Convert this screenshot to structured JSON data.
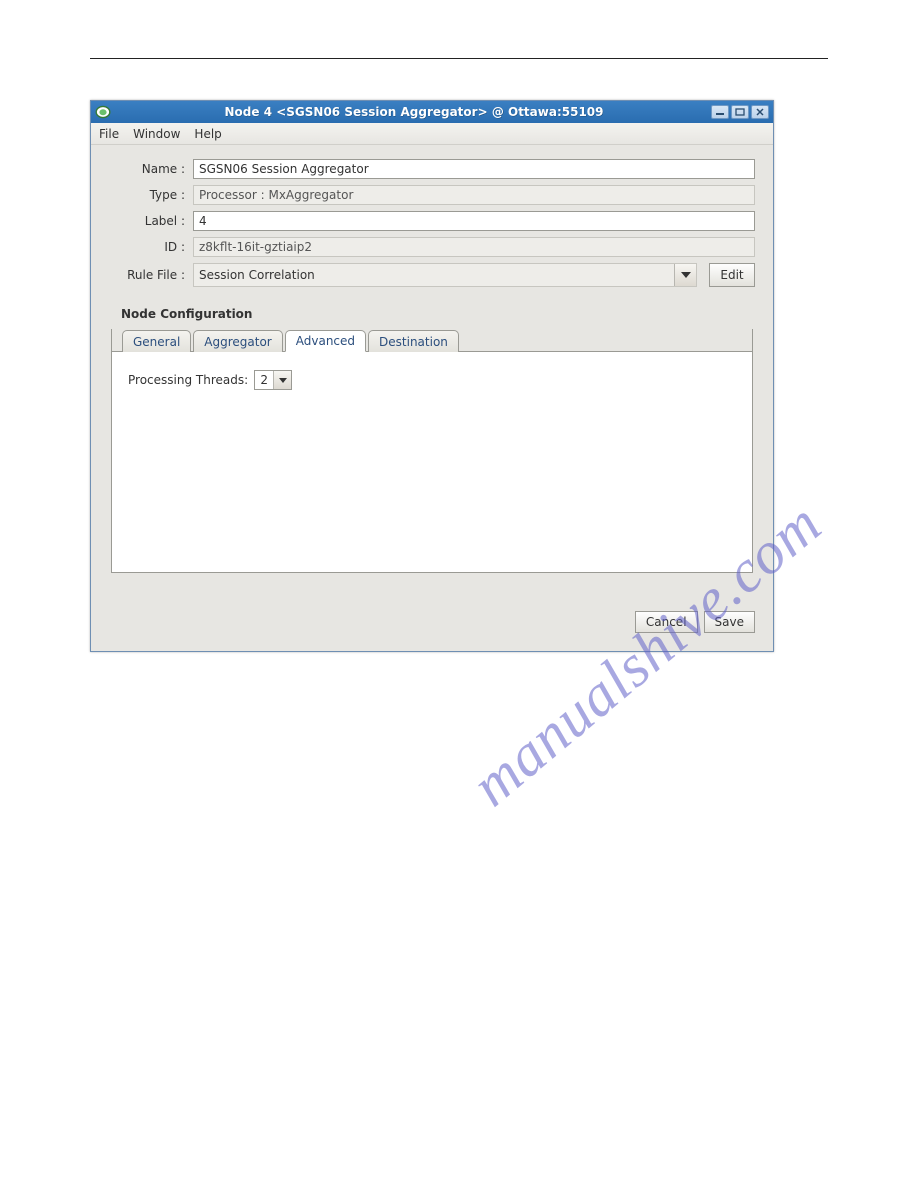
{
  "window": {
    "title": "Node 4 <SGSN06 Session Aggregator> @ Ottawa:55109"
  },
  "menubar": {
    "file": "File",
    "window": "Window",
    "help": "Help"
  },
  "form": {
    "name_label": "Name :",
    "name_value": "SGSN06 Session Aggregator",
    "type_label": "Type :",
    "type_value": "Processor : MxAggregator",
    "label_label": "Label :",
    "label_value": "4",
    "id_label": "ID :",
    "id_value": "z8kflt-16it-gztiaip2",
    "rulefile_label": "Rule File :",
    "rulefile_value": "Session Correlation",
    "edit": "Edit"
  },
  "section": {
    "title": "Node Configuration"
  },
  "tabs": {
    "general": "General",
    "aggregator": "Aggregator",
    "advanced": "Advanced",
    "destination": "Destination"
  },
  "advanced_panel": {
    "threads_label": "Processing Threads:",
    "threads_value": "2"
  },
  "buttons": {
    "cancel": "Cancel",
    "save": "Save"
  },
  "watermark": "manualshive.com"
}
